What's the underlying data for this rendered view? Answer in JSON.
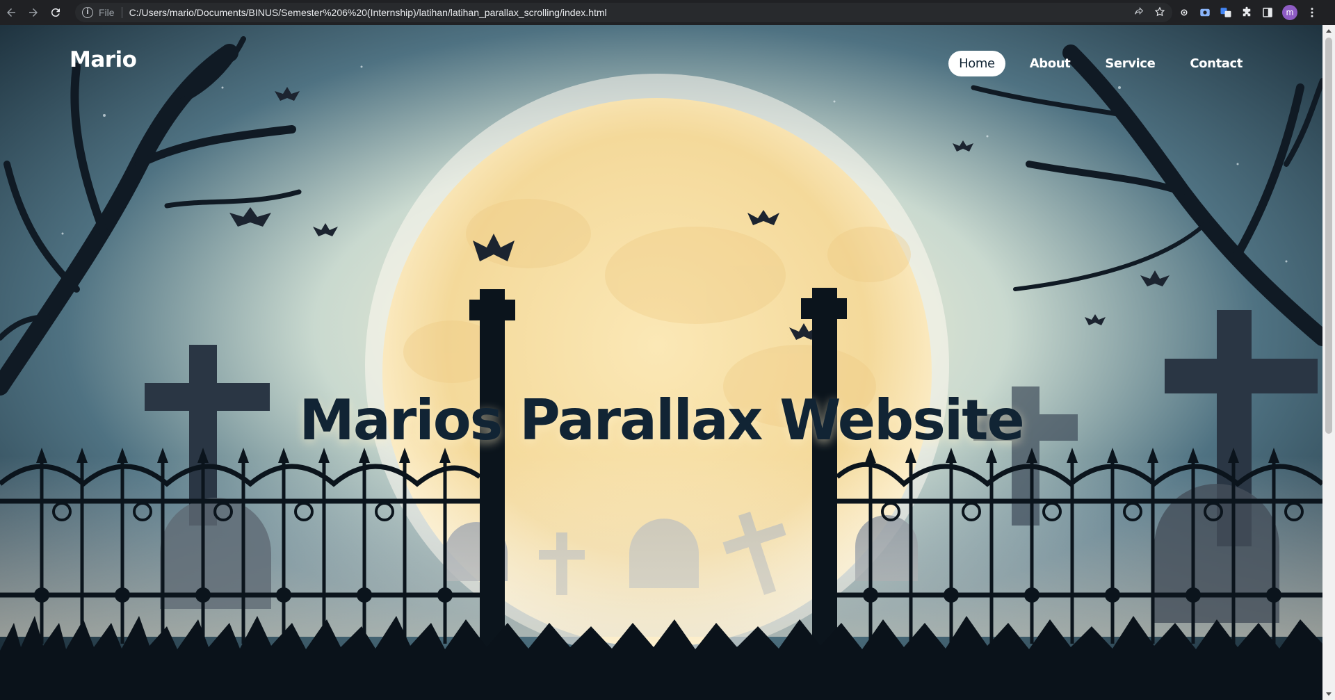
{
  "browser": {
    "scheme_label": "File",
    "url": "C:/Users/mario/Documents/BINUS/Semester%206%20(Internship)/latihan/latihan_parallax_scrolling/index.html",
    "avatar_letter": "m",
    "avatar_color": "#8e5cc4"
  },
  "site": {
    "logo": "Mario",
    "nav": [
      {
        "label": "Home",
        "active": true
      },
      {
        "label": "About",
        "active": false
      },
      {
        "label": "Service",
        "active": false
      },
      {
        "label": "Contact",
        "active": false
      }
    ],
    "hero_title": "Marios Parallax Website"
  },
  "colors": {
    "title": "#112434",
    "moon": "#f7dfa0",
    "sky": "#1f3a4a",
    "silhouette": "#0a121a"
  }
}
